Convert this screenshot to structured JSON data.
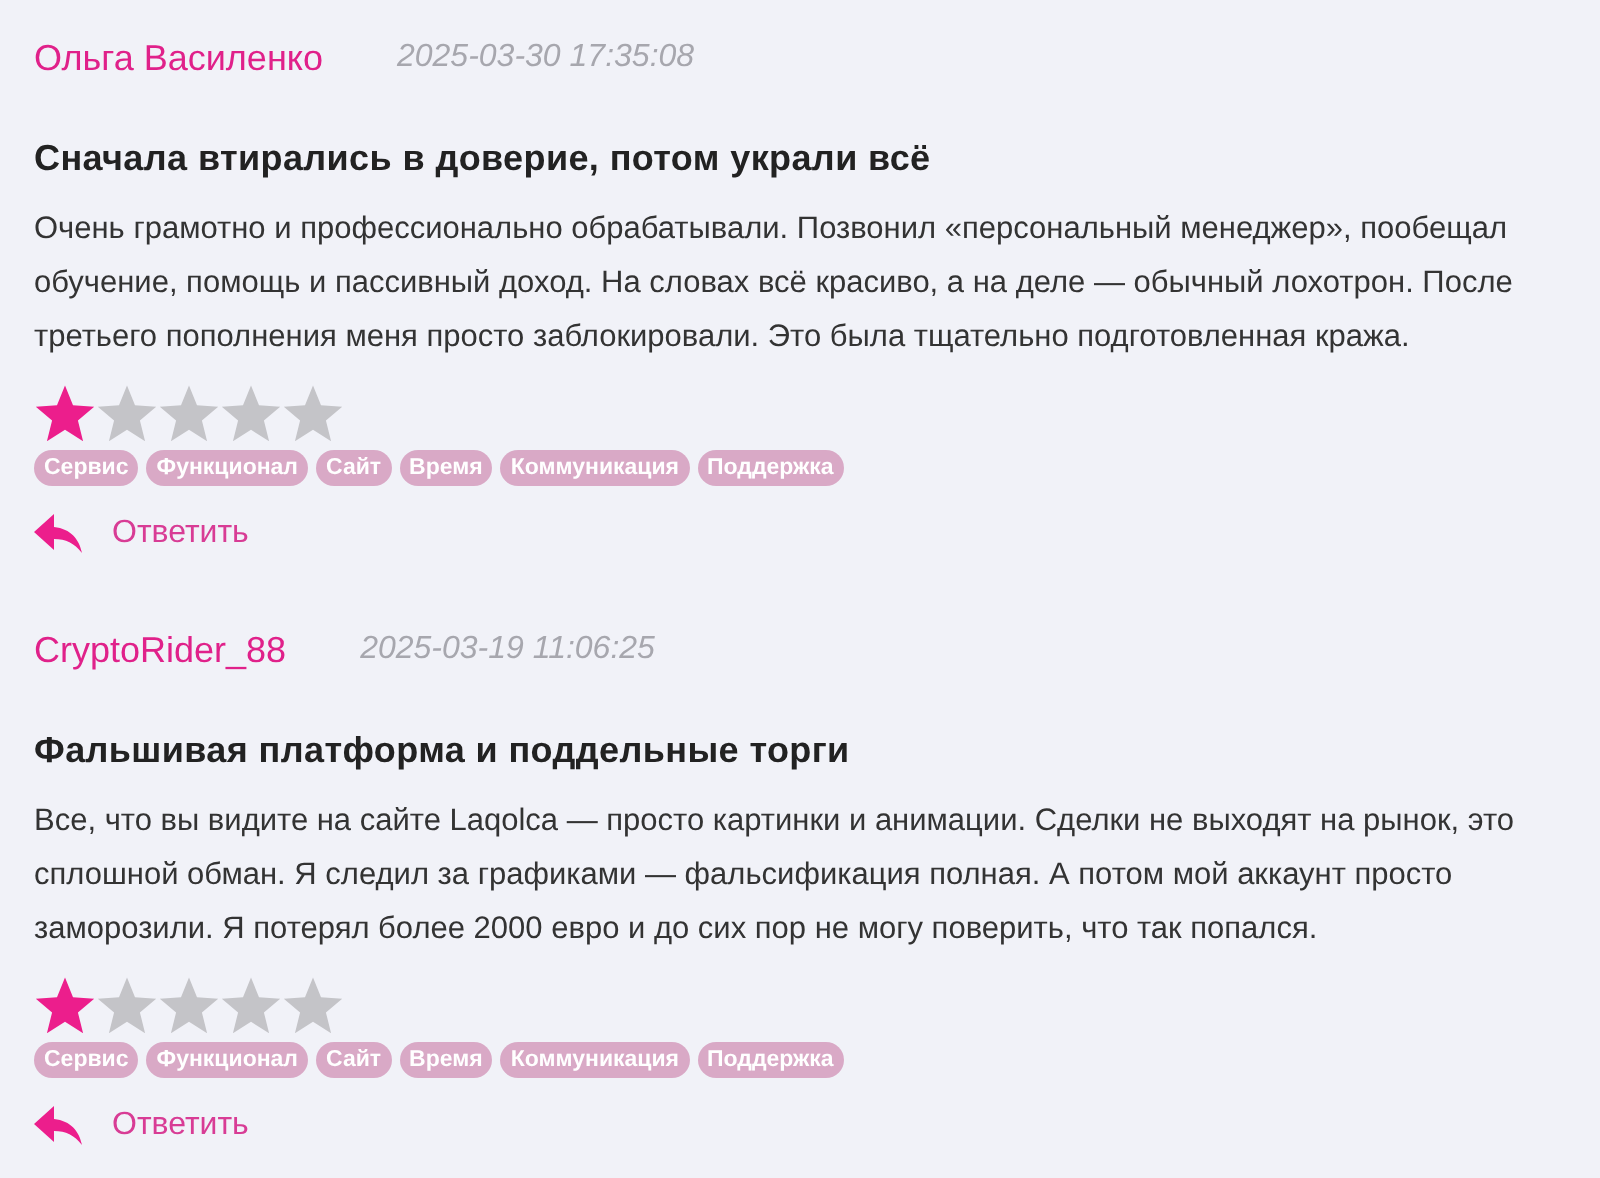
{
  "reviews": [
    {
      "author": "Ольга Василенко",
      "date": "2025-03-30 17:35:08",
      "title": "Сначала втирались в доверие, потом украли всё",
      "text": "Очень грамотно и профессионально обрабатывали. Позвонил «персональный менеджер», пообещал обучение, помощь и пассивный доход. На словах всё красиво, а на деле — обычный лохотрон. После третьего пополнения меня просто заблокировали. Это была тщательно подготовленная кража.",
      "stars": 1,
      "tags": [
        "Сервис",
        "Функционал",
        "Сайт",
        "Время",
        "Коммуникация",
        "Поддержка"
      ],
      "reply": "Ответить"
    },
    {
      "author": "CryptoRider_88",
      "date": "2025-03-19 11:06:25",
      "title": "Фальшивая платформа и поддельные торги",
      "text": "Все, что вы видите на сайте Laqolca — просто картинки и анимации. Сделки не выходят на рынок, это сплошной обман. Я следил за графиками — фальсификация полная. А потом мой аккаунт просто заморозили. Я потерял более 2000 евро и до сих пор не могу поверить, что так попался.",
      "stars": 1,
      "tags": [
        "Сервис",
        "Функционал",
        "Сайт",
        "Время",
        "Коммуникация",
        "Поддержка"
      ],
      "reply": "Ответить"
    }
  ]
}
